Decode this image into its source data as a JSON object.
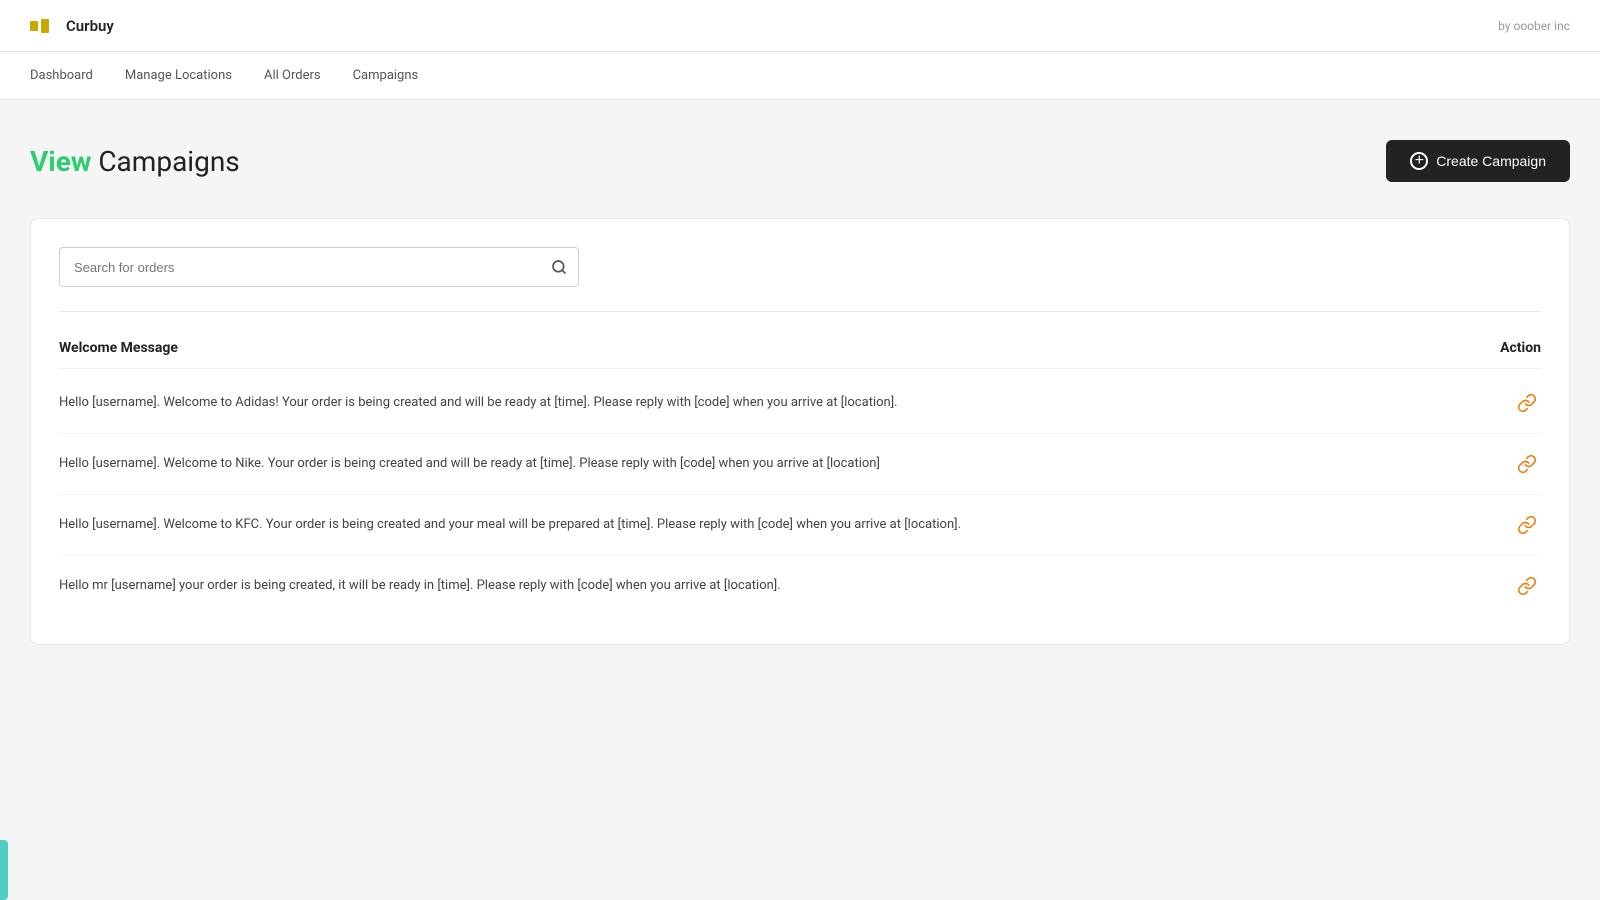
{
  "app": {
    "name": "Curbuy",
    "credit": "by ooober inc"
  },
  "nav": {
    "items": [
      {
        "label": "Dashboard",
        "id": "dashboard"
      },
      {
        "label": "Manage Locations",
        "id": "manage-locations"
      },
      {
        "label": "All Orders",
        "id": "all-orders"
      },
      {
        "label": "Campaigns",
        "id": "campaigns"
      }
    ]
  },
  "page": {
    "title_accent": "View",
    "title_rest": " Campaigns",
    "create_button_label": "Create Campaign"
  },
  "search": {
    "placeholder": "Search for orders"
  },
  "table": {
    "col_message": "Welcome Message",
    "col_action": "Action",
    "rows": [
      {
        "message": "Hello [username]. Welcome to Adidas! Your order is being created and will be ready at [time]. Please reply with [code] when you arrive at [location]."
      },
      {
        "message": "Hello [username]. Welcome to Nike. Your order is being created and will be ready at [time]. Please reply with [code] when you arrive at [location]"
      },
      {
        "message": "Hello [username]. Welcome to KFC. Your order is being created and your meal will be prepared at [time]. Please reply with [code] when you arrive at [location]."
      },
      {
        "message": "Hello mr [username] your order is being created, it will be ready in [time]. Please reply with [code] when you arrive at [location]."
      }
    ]
  },
  "icons": {
    "search": "🔍",
    "link": "🔗",
    "plus": "+"
  }
}
